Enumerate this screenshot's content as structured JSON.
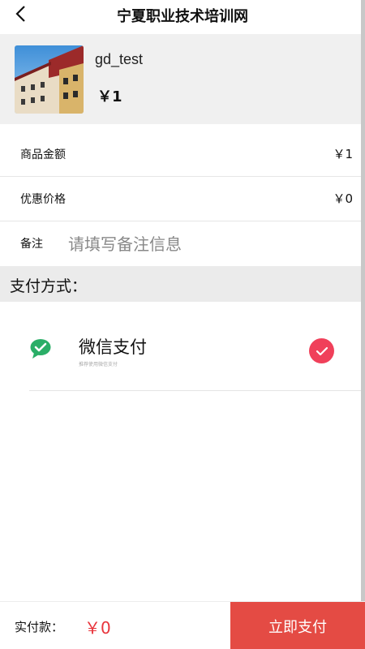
{
  "header": {
    "title": "宁夏职业技术培训网",
    "back_icon": "chevron-left-icon"
  },
  "product": {
    "name": "gd_test",
    "price": "￥1"
  },
  "order": {
    "goods_amount_label": "商品金额",
    "goods_amount_value": "￥1",
    "discount_label": "优惠价格",
    "discount_value": "￥0",
    "remark_label": "备注",
    "remark_placeholder": "请填写备注信息",
    "remark_value": ""
  },
  "payment": {
    "section_title": "支付方式：",
    "method_name": "微信支付",
    "method_desc": "推荐使用微信支付",
    "method_icon": "wechat-icon",
    "selected": true,
    "accent_color": "#f0405a",
    "wechat_color": "#2aae67"
  },
  "footer": {
    "actual_label": "实付款：",
    "actual_value": "￥0",
    "pay_button": "立即支付",
    "button_color": "#e44b44"
  }
}
